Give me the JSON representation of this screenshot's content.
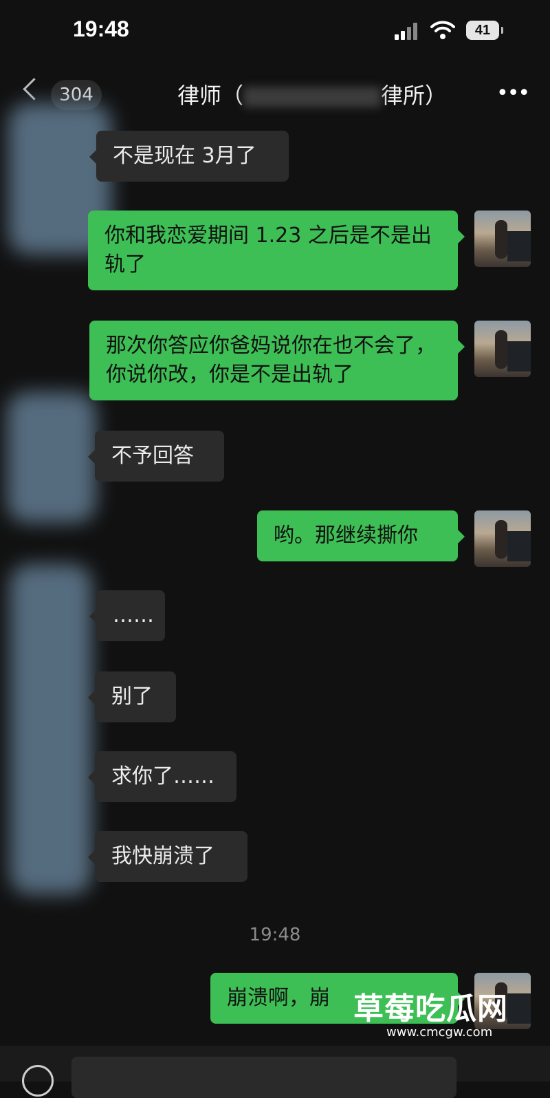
{
  "status_bar": {
    "time": "19:48",
    "battery": "41"
  },
  "header": {
    "unread_count": "304",
    "title_prefix": "律师（",
    "title_suffix": "律所）"
  },
  "messages": [
    {
      "side": "in",
      "text": "不是现在 3月了"
    },
    {
      "side": "out",
      "text": "你和我恋爱期间 1.23 之后是不是出轨了"
    },
    {
      "side": "out",
      "text": "那次你答应你爸妈说你在也不会了，你说你改，你是不是出轨了"
    },
    {
      "side": "in",
      "text": "不予回答"
    },
    {
      "side": "out",
      "text": "哟。那继续撕你"
    },
    {
      "side": "in",
      "text": "……"
    },
    {
      "side": "in",
      "text": "别了"
    },
    {
      "side": "in",
      "text": "求你了……"
    },
    {
      "side": "in",
      "text": "我快崩溃了"
    },
    {
      "side": "out",
      "text": "崩溃啊，崩"
    }
  ],
  "timestamp": "19:48",
  "watermark": {
    "text": "草莓吃瓜网",
    "url": "www.cmcgw.com"
  }
}
